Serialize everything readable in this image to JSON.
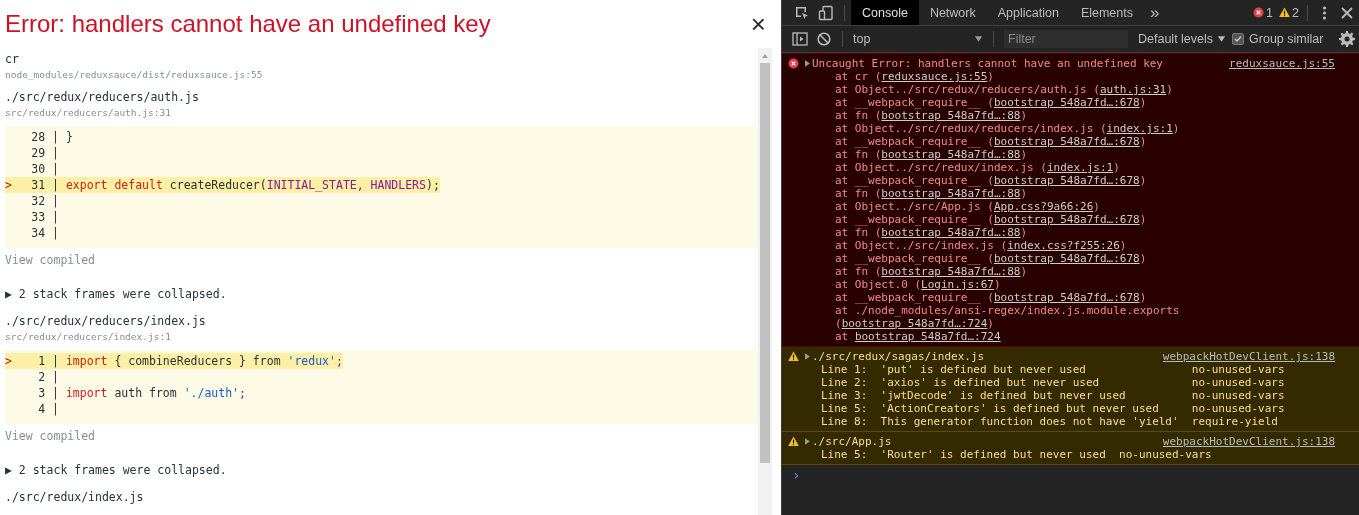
{
  "overlay": {
    "title": "Error: handlers cannot have an undefined key",
    "close": "×",
    "frames": [
      {
        "kind": "frame",
        "name": "cr",
        "location": "node_modules/reduxsauce/dist/reduxsauce.js:55"
      },
      {
        "kind": "frame",
        "name": "./src/redux/reducers/auth.js",
        "location": "src/redux/reducers/auth.js:31"
      },
      {
        "kind": "code",
        "lines": [
          {
            "number": "28 |",
            "highlighted": false,
            "tokens": [
              {
                "kind": "plain",
                "text": "}"
              }
            ]
          },
          {
            "number": "29 |",
            "highlighted": false
          },
          {
            "number": "30 |",
            "highlighted": false
          },
          {
            "number": "31 |",
            "marker": ">",
            "highlighted": true,
            "tokens": [
              {
                "kind": "keyword",
                "text": "export default"
              },
              {
                "kind": "plain",
                "text": " createReducer("
              },
              {
                "kind": "var",
                "text": "INITIAL_STATE, HANDLERS"
              },
              {
                "kind": "plain",
                "text": ");"
              }
            ]
          },
          {
            "number": "32 |",
            "highlighted": false
          },
          {
            "number": "33 |",
            "highlighted": false
          },
          {
            "number": "34 |",
            "highlighted": false
          }
        ]
      },
      {
        "kind": "link",
        "text": "View compiled"
      },
      {
        "kind": "collapsed",
        "text": "▶ 2 stack frames were collapsed."
      },
      {
        "kind": "frame",
        "name": "./src/redux/reducers/index.js",
        "location": "src/redux/reducers/index.js:1"
      },
      {
        "kind": "code",
        "lines": [
          {
            "number": "1 |",
            "marker": ">",
            "highlighted": true,
            "tokens": [
              {
                "kind": "keyword",
                "text": "import"
              },
              {
                "kind": "plain",
                "text": " { combineReducers } from "
              },
              {
                "kind": "string",
                "text": "'redux'"
              },
              {
                "kind": "var",
                "text": ";"
              }
            ]
          },
          {
            "number": "2 |",
            "highlighted": false
          },
          {
            "number": "3 |",
            "highlighted": false,
            "tokens": [
              {
                "kind": "keyword",
                "text": "import"
              },
              {
                "kind": "plain",
                "text": " auth from "
              },
              {
                "kind": "string",
                "text": "'./auth'"
              },
              {
                "kind": "var",
                "text": ";"
              }
            ]
          },
          {
            "number": "4 |",
            "highlighted": false
          }
        ]
      },
      {
        "kind": "link",
        "text": "View compiled"
      },
      {
        "kind": "collapsed",
        "text": "▶ 2 stack frames were collapsed."
      },
      {
        "kind": "frame",
        "name": "./src/redux/index.js"
      }
    ]
  },
  "devtools": {
    "tabs": [
      {
        "label": "Console",
        "selected": true
      },
      {
        "label": "Network",
        "selected": false
      },
      {
        "label": "Application",
        "selected": false
      },
      {
        "label": "Elements",
        "selected": false
      }
    ],
    "more_tabs": "»",
    "error_count": "1",
    "warning_count": "2",
    "context": "top",
    "filter": {
      "placeholder": "Filter"
    },
    "levels": "Default levels",
    "group_similar": {
      "label": "Group similar",
      "checked": true
    },
    "messages": [
      {
        "kind": "error",
        "text": "Uncaught Error: handlers cannot have an undefined key",
        "source": "reduxsauce.js:55",
        "stack": [
          {
            "prefix": "at cr (",
            "link": "reduxsauce.js:55",
            "suffix": ")"
          },
          {
            "prefix": "at Object../src/redux/reducers/auth.js (",
            "link": "auth.js:31",
            "suffix": ")"
          },
          {
            "prefix": "at __webpack_require__ (",
            "link": "bootstrap 548a7fd…:678",
            "suffix": ")"
          },
          {
            "prefix": "at fn (",
            "link": "bootstrap 548a7fd…:88",
            "suffix": ")"
          },
          {
            "prefix": "at Object../src/redux/reducers/index.js (",
            "link": "index.js:1",
            "suffix": ")"
          },
          {
            "prefix": "at __webpack_require__ (",
            "link": "bootstrap 548a7fd…:678",
            "suffix": ")"
          },
          {
            "prefix": "at fn (",
            "link": "bootstrap 548a7fd…:88",
            "suffix": ")"
          },
          {
            "prefix": "at Object../src/redux/index.js (",
            "link": "index.js:1",
            "suffix": ")"
          },
          {
            "prefix": "at __webpack_require__ (",
            "link": "bootstrap 548a7fd…:678",
            "suffix": ")"
          },
          {
            "prefix": "at fn (",
            "link": "bootstrap 548a7fd…:88",
            "suffix": ")"
          },
          {
            "prefix": "at Object../src/App.js (",
            "link": "App.css?9a66:26",
            "suffix": ")"
          },
          {
            "prefix": "at __webpack_require__ (",
            "link": "bootstrap 548a7fd…:678",
            "suffix": ")"
          },
          {
            "prefix": "at fn (",
            "link": "bootstrap 548a7fd…:88",
            "suffix": ")"
          },
          {
            "prefix": "at Object../src/index.js (",
            "link": "index.css?f255:26",
            "suffix": ")"
          },
          {
            "prefix": "at __webpack_require__ (",
            "link": "bootstrap 548a7fd…:678",
            "suffix": ")"
          },
          {
            "prefix": "at fn (",
            "link": "bootstrap 548a7fd…:88",
            "suffix": ")"
          },
          {
            "prefix": "at Object.0 (",
            "link": "Login.js:67",
            "suffix": ")"
          },
          {
            "prefix": "at __webpack_require__ (",
            "link": "bootstrap 548a7fd…:678",
            "suffix": ")"
          },
          {
            "prefix": "at ./node_modules/ansi-regex/index.js.module.exports (",
            "link": "bootstrap 548a7fd…:724",
            "suffix": ")"
          },
          {
            "prefix": "at ",
            "link": "bootstrap 548a7fd…:724"
          }
        ]
      },
      {
        "kind": "warning",
        "text": "./src/redux/sagas/index.js",
        "source": "webpackHotDevClient.js:138",
        "details": [
          {
            "message": "Line 1:  'put' is defined but never used",
            "rule": "no-unused-vars"
          },
          {
            "message": "Line 2:  'axios' is defined but never used",
            "rule": "no-unused-vars"
          },
          {
            "message": "Line 3:  'jwtDecode' is defined but never used",
            "rule": "no-unused-vars"
          },
          {
            "message": "Line 5:  'ActionCreators' is defined but never used",
            "rule": "no-unused-vars"
          },
          {
            "message": "Line 8:  This generator function does not have 'yield'",
            "rule": "require-yield"
          }
        ]
      },
      {
        "kind": "warning",
        "text": "./src/App.js",
        "source": "webpackHotDevClient.js:138",
        "details": [
          {
            "message": "Line 5:  'Router' is defined but never used",
            "rule": "no-unused-vars"
          }
        ]
      }
    ],
    "prompt": "›"
  }
}
